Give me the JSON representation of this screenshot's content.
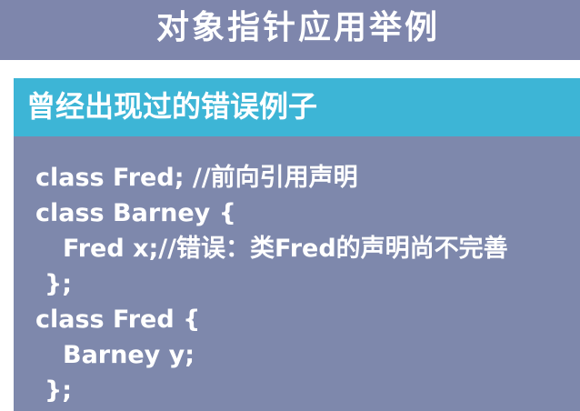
{
  "slide": {
    "title": "对象指针应用举例",
    "section_header": "曾经出现过的错误例子",
    "code_lines": [
      "class Fred; //前向引用声明",
      "class Barney {",
      "Fred x;//错误：类Fred的声明尚不完善",
      "};",
      "class Fred {",
      "Barney y;",
      "};"
    ]
  },
  "colors": {
    "title_bar": "#7e86ac",
    "header_bar": "#3db5d6",
    "panel": "#7e88ac",
    "text": "#ffffff"
  }
}
